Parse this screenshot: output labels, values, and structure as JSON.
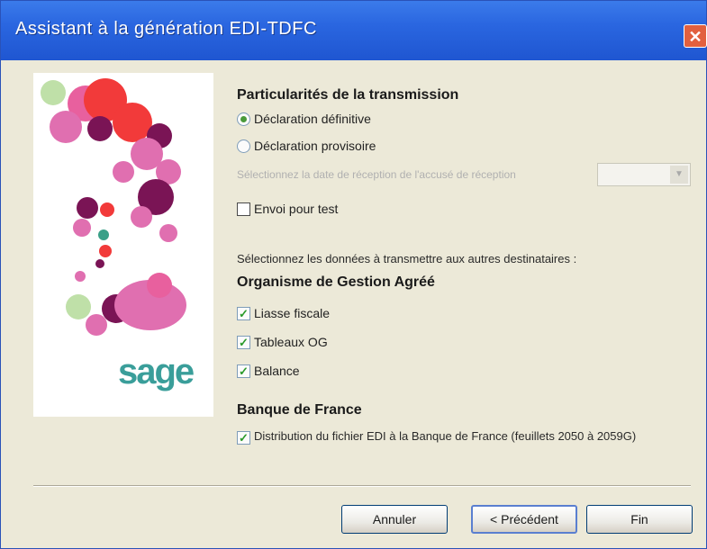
{
  "window": {
    "title": "Assistant à la génération EDI-TDFC",
    "close_glyph": "✕"
  },
  "brand": {
    "logo_text": "sage"
  },
  "transmission": {
    "heading": "Particularités de la transmission",
    "options": [
      {
        "label": "Déclaration définitive",
        "selected": true
      },
      {
        "label": "Déclaration provisoire",
        "selected": false
      }
    ],
    "provisoire_note": "Sélectionnez la date de réception de l'accusé de réception",
    "provisoire_select_value": "",
    "test_checkbox": {
      "label": "Envoi pour test",
      "checked": false
    }
  },
  "destinataires": {
    "info": "Sélectionnez les données à transmettre aux autres destinataires :",
    "oga": {
      "heading": "Organisme de Gestion Agréé",
      "items": [
        {
          "label": "Liasse fiscale",
          "checked": true
        },
        {
          "label": "Tableaux OG",
          "checked": true
        },
        {
          "label": "Balance",
          "checked": true
        }
      ]
    },
    "bdf": {
      "heading": "Banque de France",
      "item": {
        "label": "Distribution du fichier EDI à la Banque de France (feuillets 2050 à 2059G)",
        "checked": true
      }
    }
  },
  "buttons": {
    "cancel": "Annuler",
    "previous": "< Précédent",
    "finish": "Fin"
  },
  "colors": {
    "titlebar": "#2a66e0",
    "dialog_bg": "#ece9d8",
    "check_mark": "#2a9a2a"
  }
}
